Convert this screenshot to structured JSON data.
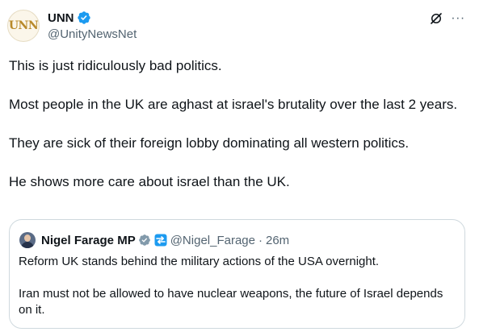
{
  "author": {
    "display_name": "UNN",
    "handle": "@UnityNewsNet",
    "avatar_text": "UNN",
    "verified": true
  },
  "tweet": {
    "paragraphs": [
      "This is just ridiculously bad politics.",
      "Most people in the UK are aghast at israel's brutality over the last 2 years.",
      "They are sick of their foreign lobby dominating all western politics.",
      "He shows more care about israel than the UK."
    ]
  },
  "quoted": {
    "display_name": "Nigel Farage MP",
    "handle": "@Nigel_Farage",
    "separator": "·",
    "time": "26m",
    "paragraphs": [
      "Reform UK stands behind the military actions of the USA overnight.",
      "Iran must not be allowed to have nuclear weapons, the future of Israel depends on it."
    ]
  },
  "icons": {
    "verified": "verified-badge-icon",
    "grok": "grok-icon",
    "more": "more-options-icon",
    "government": "government-badge-icon",
    "affiliate": "affiliate-icon"
  },
  "colors": {
    "verified_blue": "#1d9bf0",
    "government_gray": "#829aab",
    "text_primary": "#0f1419",
    "text_secondary": "#536471",
    "border": "#cfd9de",
    "avatar_gold": "#b8892a"
  }
}
